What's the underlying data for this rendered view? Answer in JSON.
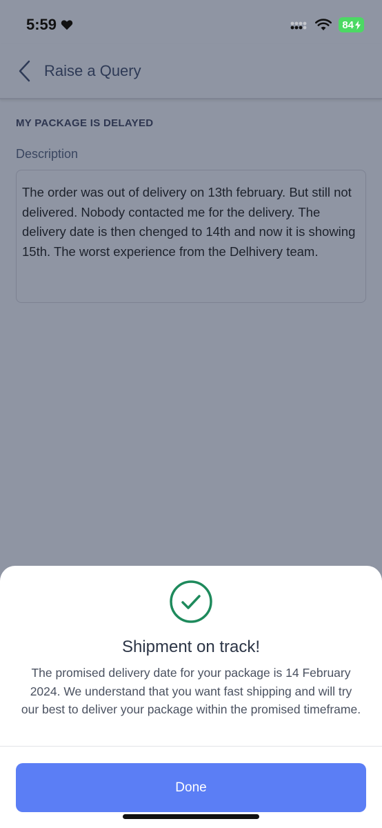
{
  "status_bar": {
    "time": "5:59",
    "battery": "84",
    "icons": [
      "heart-icon",
      "signal-icon",
      "wifi-icon",
      "battery-icon"
    ]
  },
  "header": {
    "title": "Raise a Query",
    "back_icon": "chevron-left-icon"
  },
  "query": {
    "category": "MY PACKAGE IS DELAYED",
    "description_label": "Description",
    "description_text": "The order was out of delivery on 13th february. But still not delivered. Nobody contacted me for the delivery. The delivery date is then chenged to 14th and now it is showing 15th. The worst experience from the Delhivery team."
  },
  "sheet": {
    "icon": "check-circle-icon",
    "title": "Shipment on track!",
    "message": "The promised delivery date for your package is 14 February 2024. We understand that you want fast shipping and will try our best to deliver your package within the promised timeframe.",
    "done_label": "Done"
  },
  "colors": {
    "overlay_bg": "#8f95a3",
    "accent": "#5b7ef5",
    "success": "#1e8a5c",
    "battery": "#4cd964"
  }
}
